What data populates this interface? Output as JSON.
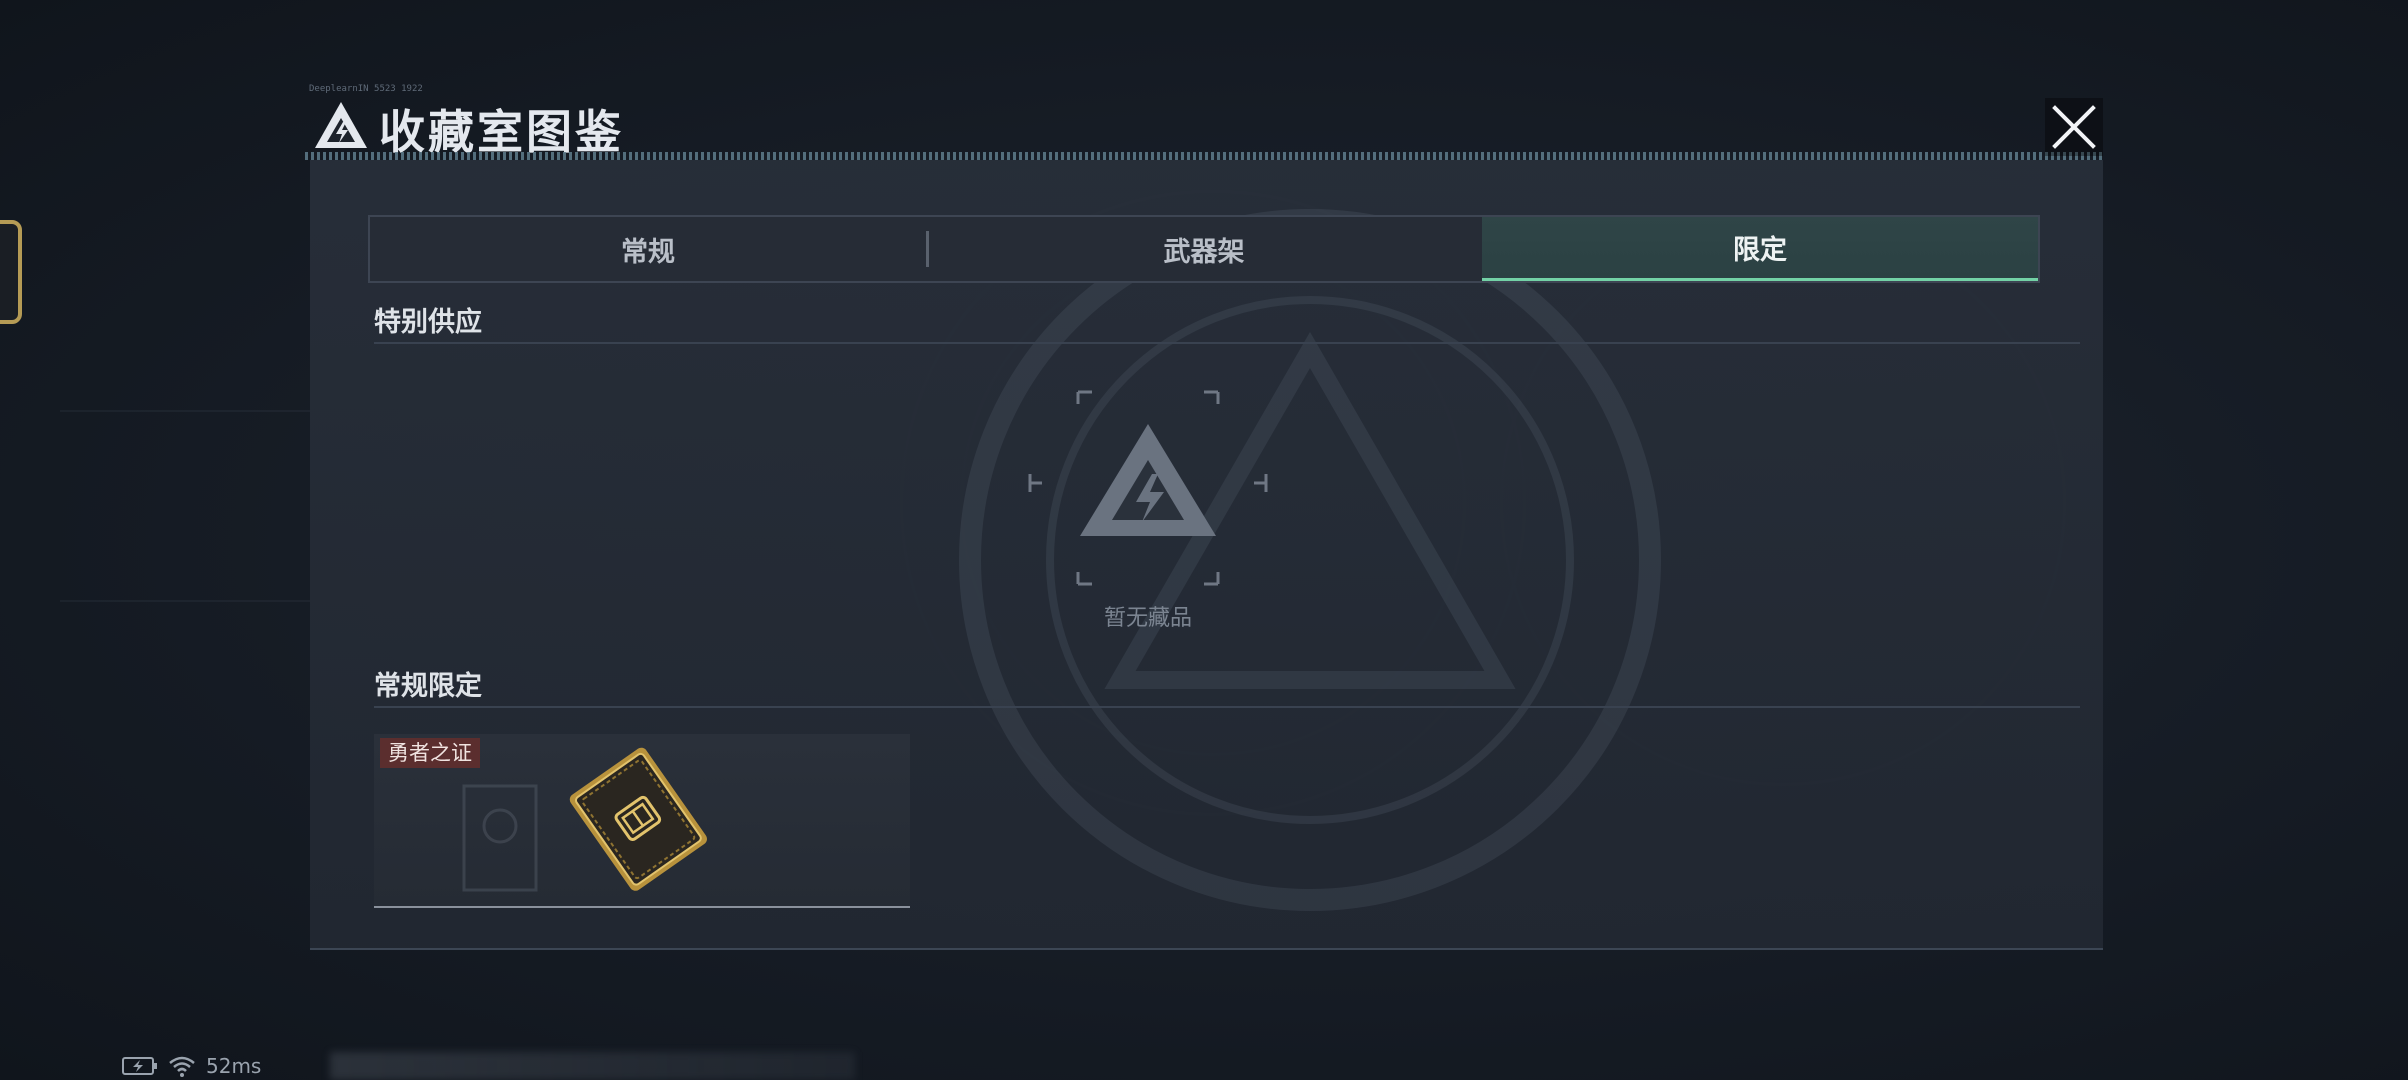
{
  "modal": {
    "title": "收藏室图鉴",
    "subcode": "DeeplearnIN 5523 1922",
    "close_icon": "close-icon"
  },
  "tabs": [
    {
      "label": "常规",
      "active": false
    },
    {
      "label": "武器架",
      "active": false
    },
    {
      "label": "限定",
      "active": true
    }
  ],
  "sections": {
    "special": {
      "title": "特别供应",
      "empty_text": "暂无藏品"
    },
    "regular_limited": {
      "title": "常规限定",
      "items": [
        {
          "tag": "勇者之证",
          "icon": "gold-card-icon"
        }
      ]
    }
  },
  "status_bar": {
    "ping": "52ms",
    "battery_icon": "battery-charging-icon",
    "wifi_icon": "wifi-icon"
  },
  "colors": {
    "accent": "#73d2a6",
    "tag_bg": "#5b2e2e",
    "gold": "#c8a44a"
  }
}
